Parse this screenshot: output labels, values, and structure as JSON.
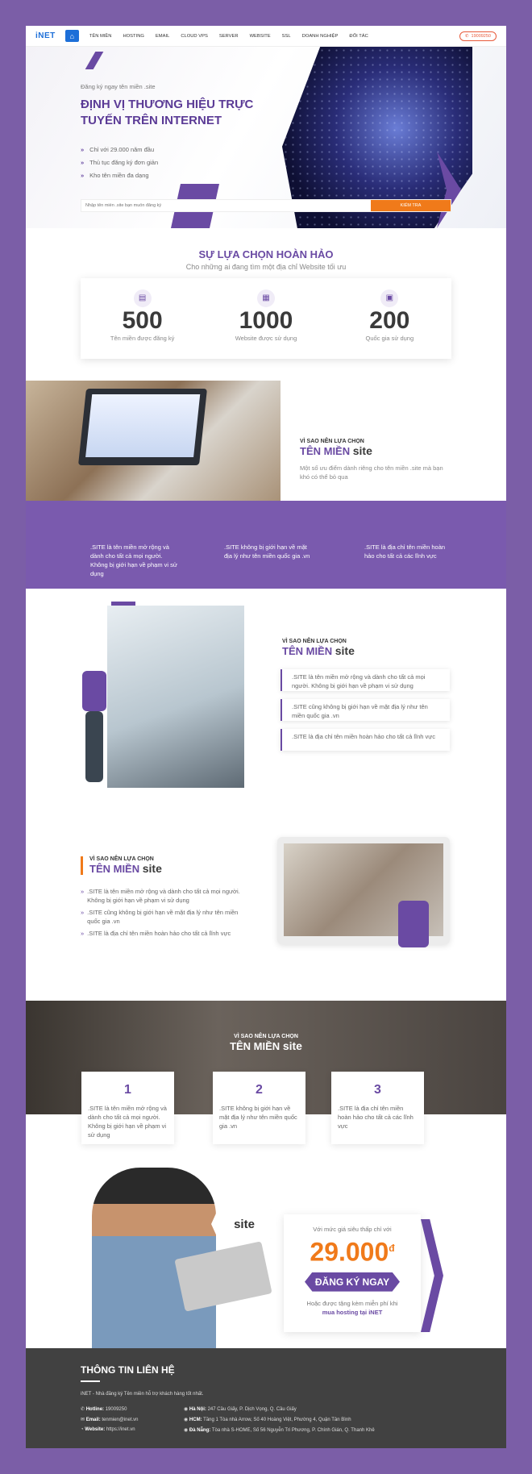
{
  "nav": {
    "logo": "iNET",
    "menu": [
      "TÊN MIỀN",
      "HOSTING",
      "EMAIL",
      "CLOUD VPS",
      "SERVER",
      "WEBSITE",
      "SSL",
      "DOANH NGHIỆP",
      "ĐỐI TÁC"
    ],
    "hotline": "19009250"
  },
  "hero": {
    "sub": "Đăng ký ngay tên miền .site",
    "title": "ĐỊNH VỊ THƯƠNG HIỆU TRỰC TUYẾN TRÊN INTERNET",
    "points": [
      "Chỉ với 29.000 năm đầu",
      "Thủ tục đăng ký đơn giản",
      "Kho tên miền đa dạng"
    ],
    "search_placeholder": "Nhập tên miền .site bạn muốn đăng ký",
    "search_button": "KIỂM TRA"
  },
  "choice": {
    "title": "SỰ LỰA CHỌN HOÀN HẢO",
    "subtitle": "Cho những ai đang tìm một địa chỉ Website tối ưu",
    "stats": [
      {
        "num": "500",
        "label": "Tên miền được đăng ký"
      },
      {
        "num": "1000",
        "label": "Website được sử dụng"
      },
      {
        "num": "200",
        "label": "Quốc gia sử dụng"
      }
    ]
  },
  "why1": {
    "small": "VÌ SAO NÊN LỰA CHỌN",
    "big": "TÊN MIỀN",
    "tld": "site",
    "desc": "Một số ưu điểm dành riêng cho tên miền .site mà bạn khó có thể bỏ qua",
    "points": [
      ".SITE là tên miền mở rộng và dành cho tất cả mọi người. Không bị giới hạn về phạm vi sử dụng",
      ".SITE không bị giới hạn về mặt địa lý như tên miền quốc gia .vn",
      ".SITE là địa chỉ tên miền hoàn hảo cho tất cả các lĩnh vực"
    ]
  },
  "why2": {
    "small": "VÌ SAO NÊN LỰA CHỌN",
    "big": "TÊN MIỀN",
    "tld": "site",
    "points": [
      ".SITE là tên miền mở rộng và dành cho tất cả mọi người. Không bị giới hạn về phạm vi sử dụng",
      ".SITE cũng không bị giới hạn về mặt địa lý như tên miền quốc gia .vn",
      ".SITE là địa chỉ tên miền hoàn hảo cho tất cả lĩnh vực"
    ]
  },
  "why3": {
    "small": "VÌ SAO NÊN LỰA CHỌN",
    "big": "TÊN MIỀN",
    "tld": "site",
    "points": [
      ".SITE là tên miền mở rộng và dành cho tất cả mọi người. Không bị giới hạn về phạm vi sử dụng",
      ".SITE cũng không bị giới hạn về mặt địa lý như tên miền quốc gia .vn",
      ".SITE là địa chỉ tên miền hoàn hảo cho tất cả lĩnh vực"
    ]
  },
  "why4": {
    "small": "VÌ SAO NÊN LỰA CHỌN",
    "big": "TÊN MIỀN",
    "tld": "site",
    "cards": [
      {
        "n": "1",
        "text": ".SITE là tên miền mở rộng và dành cho tất cả mọi người. Không bị giới hạn về phạm vi sử dụng"
      },
      {
        "n": "2",
        "text": ".SITE không bị giới hạn về mặt địa lý như tên miền quốc gia .vn"
      },
      {
        "n": "3",
        "text": ".SITE là địa chỉ tên miền hoàn hảo cho tất cả các lĩnh vực"
      }
    ]
  },
  "promo": {
    "tld": "site",
    "price_intro": "Với mức giá siêu thấp chỉ với",
    "price": "29.000",
    "currency": "đ",
    "cta": "ĐĂNG KÝ NGAY",
    "note1": "Hoặc được tặng kèm miễn phí khi",
    "note2": "mua hosting tại iNET"
  },
  "footer": {
    "title": "THÔNG TIN LIÊN HỆ",
    "desc": "iNET - Nhà đăng ký Tên miền hỗ trợ khách hàng tốt nhất.",
    "hotline_label": "Hotline:",
    "hotline": "19009250",
    "email_label": "Email:",
    "email": "tenmien@inet.vn",
    "website_label": "Website:",
    "website": "https://inet.vn",
    "hn_label": "Hà Nội:",
    "hn": "247 Cầu Giấy, P. Dịch Vọng, Q. Cầu Giấy",
    "hcm_label": "HCM:",
    "hcm": "Tầng 1 Tòa nhà Arrow, Số 40 Hoàng Việt, Phường 4, Quận Tân Bình",
    "dn_label": "Đà Nẵng:",
    "dn": "Tòa nhà S-HOME, Số 56 Nguyễn Tri Phương, P. Chính Gián, Q. Thanh Khê"
  }
}
